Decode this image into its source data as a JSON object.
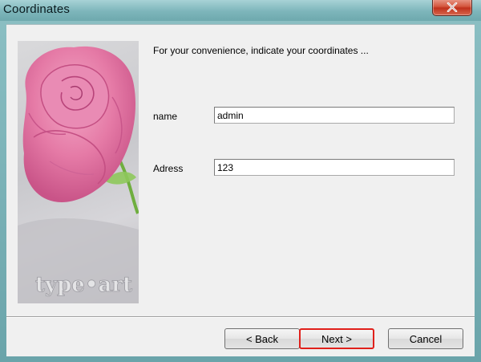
{
  "window": {
    "title": "Coordinates"
  },
  "intro": {
    "text": "For your convenience, indicate your coordinates ..."
  },
  "form": {
    "name_label": "name",
    "name_value": "admin",
    "address_label": "Adress",
    "address_value": "123"
  },
  "illustration": {
    "logo_text": "type•art"
  },
  "buttons": {
    "back_label": "< Back",
    "next_label": "Next >",
    "cancel_label": "Cancel"
  },
  "colors": {
    "titlebar": "#7db5ba",
    "close_button": "#c0311c",
    "dialog_background": "#f0f0f0",
    "focus_highlight": "#e0201b",
    "rose": "#e87aa8"
  }
}
